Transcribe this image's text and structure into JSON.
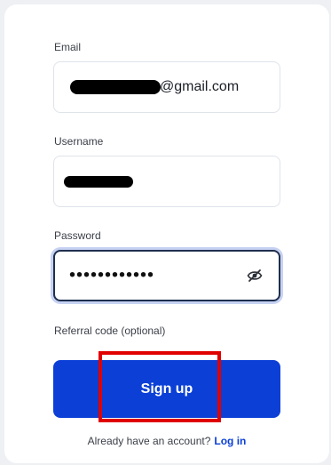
{
  "form": {
    "email": {
      "label": "Email",
      "value_visible_suffix": "@gmail.com"
    },
    "username": {
      "label": "Username"
    },
    "password": {
      "label": "Password",
      "masked_value": "••••••••••••",
      "toggle_icon": "eye-off-icon"
    },
    "referral": {
      "label": "Referral code (optional)"
    },
    "submit_label": "Sign up",
    "login_prompt": "Already have an account?",
    "login_link": "Log in"
  },
  "colors": {
    "primary": "#0b3fd6",
    "highlight": "#e00000",
    "focus_ring": "#c7d2f3"
  }
}
